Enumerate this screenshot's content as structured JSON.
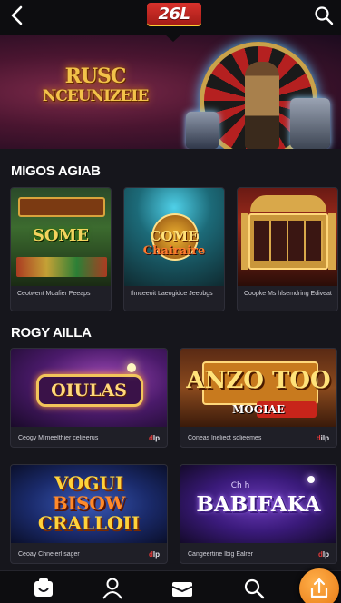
{
  "header": {
    "logo_text": "26L",
    "back_icon": "chevron-left-icon",
    "search_icon": "search-icon"
  },
  "hero": {
    "title_line1": "RUSC",
    "title_line2": "NCEUNIZEIE"
  },
  "section1": {
    "title": "MIGOS AGIAB",
    "cards": [
      {
        "art_text": "SOME",
        "caption": "Ceotwent Mdafier Peeaps"
      },
      {
        "art_text_top": "COME",
        "art_text_bottom": "Chairaire",
        "caption": "Ilmceeoit Laeogidce Jeeobgs"
      },
      {
        "art_text": "",
        "caption": "Coopke Ms hlsemdring Ediveat"
      }
    ]
  },
  "section2": {
    "title": "ROGY AILLA",
    "cards": [
      {
        "art_text": "OIULAS",
        "caption": "Ceogy Mlmeelthier celieerus",
        "badge_d": "d",
        "badge_text": "lp"
      },
      {
        "art_text_top": "ANZO TOO",
        "art_text_bottom": "MOGIAE",
        "caption": "Coneas lneliect solieemes",
        "badge_d": "d",
        "badge_text": "ilp"
      },
      {
        "art_text_top": "VOGUI",
        "art_text_mid": "BISOW",
        "art_text_bottom": "CRALLOII",
        "caption": "Ceoay Chnelerl sager",
        "badge_d": "d",
        "badge_text": "lp"
      },
      {
        "art_text": "BABIFAKA",
        "art_text_small": "Ch h",
        "caption": "Cangeertine Ibig Ealrer",
        "badge_d": "d",
        "badge_text": "lp"
      }
    ]
  },
  "nav": {
    "items": [
      "home-icon",
      "profile-icon",
      "wallet-icon",
      "search-icon",
      "upload-icon"
    ]
  },
  "colors": {
    "background": "#16161c",
    "topbar": "#0d0d10",
    "logo": "#d8322c",
    "accent": "#e87914"
  }
}
